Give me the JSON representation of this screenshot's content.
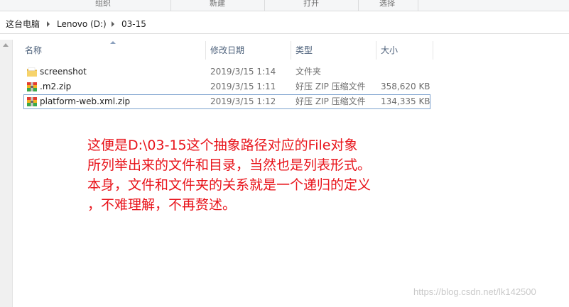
{
  "ribbon": {
    "groups": [
      "组织",
      "新建",
      "打开",
      "选择"
    ]
  },
  "address": {
    "crumbs": [
      "这台电脑",
      "Lenovo (D:)",
      "03-15"
    ]
  },
  "columns": {
    "name": "名称",
    "date": "修改日期",
    "type": "类型",
    "size": "大小"
  },
  "files": [
    {
      "name": "screenshot",
      "date": "2019/3/15 1:14",
      "type": "文件夹",
      "size": "",
      "icon": "folder-icon"
    },
    {
      "name": ".m2.zip",
      "date": "2019/3/15 1:11",
      "type": "好压 ZIP 压缩文件",
      "size": "358,620 KB",
      "icon": "zip-archive-icon"
    },
    {
      "name": "platform-web.xml.zip",
      "date": "2019/3/15 1:12",
      "type": "好压 ZIP 压缩文件",
      "size": "134,335 KB",
      "icon": "zip-archive-icon"
    }
  ],
  "annotation": {
    "lines": [
      "这便是D:\\03-15这个抽象路径对应的File对象",
      "所列举出来的文件和目录，当然也是列表形式。",
      "本身，文件和文件夹的关系就是一个递归的定义",
      "，不难理解，不再赘述。"
    ],
    "color": "#e8141b"
  },
  "watermark": "https://blog.csdn.net/lk142500"
}
